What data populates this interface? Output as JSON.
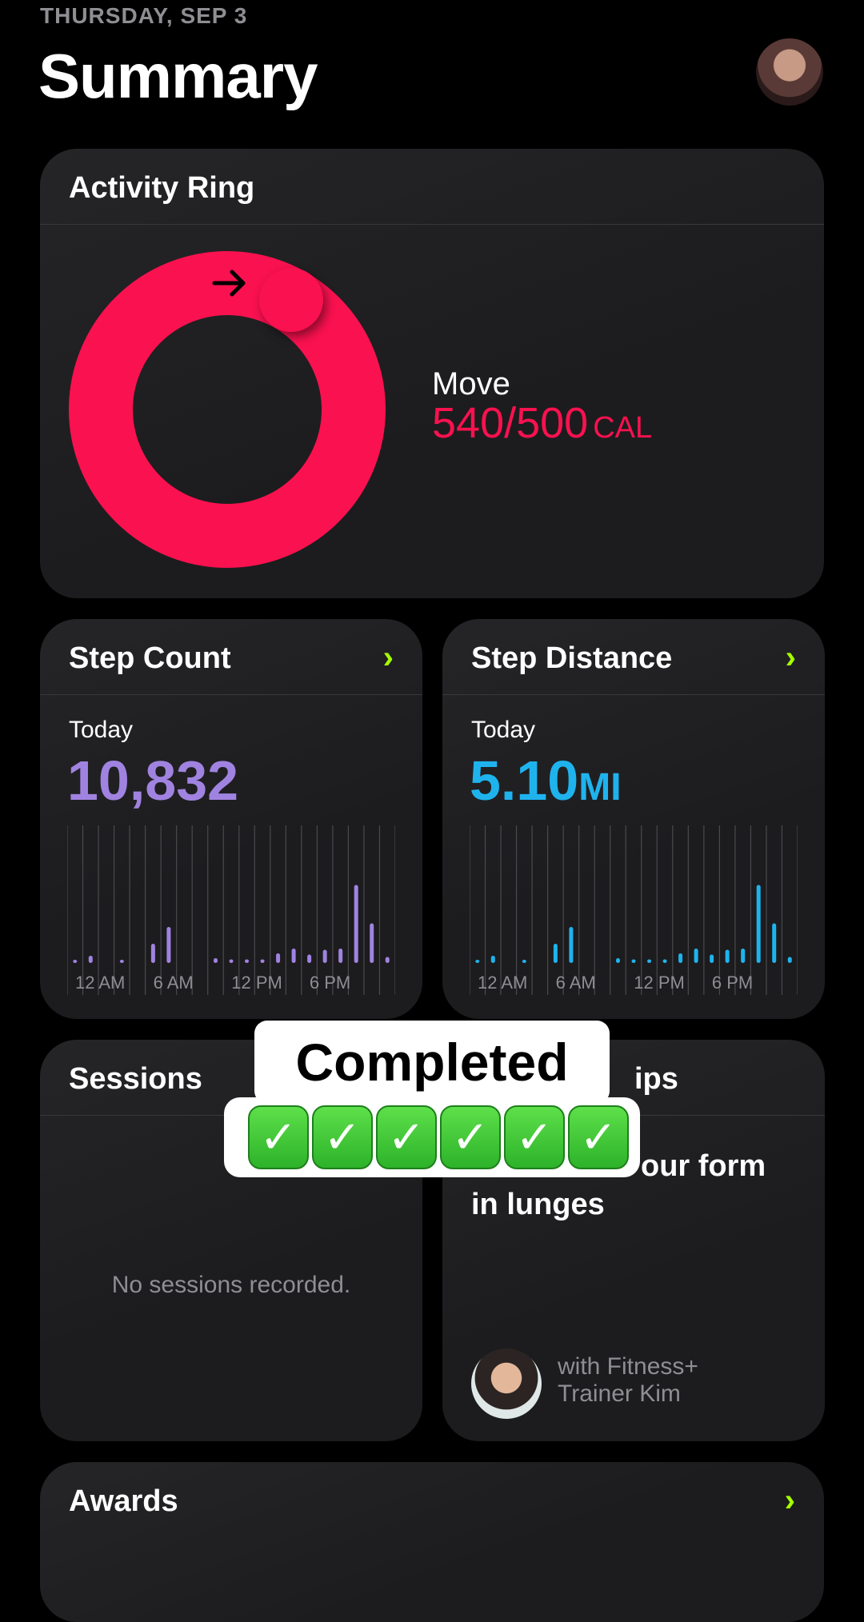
{
  "header": {
    "date": "THURSDAY, SEP 3",
    "title": "Summary"
  },
  "activity": {
    "title": "Activity Ring",
    "move_label": "Move",
    "move_value": "540/500",
    "move_unit": "CAL",
    "move_fraction": 1.08,
    "ring_color": "#fa114f"
  },
  "steps": {
    "title": "Step Count",
    "today_label": "Today",
    "value": "10,832",
    "color": "#a083e0",
    "chart_data": {
      "type": "bar",
      "x_tick_labels": [
        "12 AM",
        "6 AM",
        "12 PM",
        "6 PM"
      ],
      "values": [
        0.02,
        0.06,
        0,
        0.02,
        0,
        0.16,
        0.3,
        0,
        0,
        0.04,
        0.03,
        0.03,
        0.03,
        0.08,
        0.12,
        0.07,
        0.11,
        0.12,
        0.65,
        0.33,
        0.05,
        0
      ]
    }
  },
  "distance": {
    "title": "Step Distance",
    "today_label": "Today",
    "value": "5.10",
    "unit": "MI",
    "color": "#1fb3ee",
    "chart_data": {
      "type": "bar",
      "x_tick_labels": [
        "12 AM",
        "6 AM",
        "12 PM",
        "6 PM"
      ],
      "values": [
        0.02,
        0.06,
        0,
        0.02,
        0,
        0.16,
        0.3,
        0,
        0,
        0.04,
        0.03,
        0.03,
        0.03,
        0.08,
        0.12,
        0.07,
        0.11,
        0.12,
        0.65,
        0.33,
        0.05,
        0
      ]
    }
  },
  "sessions": {
    "title": "Sessions",
    "empty_text": "No sessions recorded."
  },
  "tips": {
    "title_visible": "ips",
    "text_line1": "our form",
    "text_line2": "in lunges",
    "trainer_line1": "with Fitness+",
    "trainer_line2": "Trainer Kim"
  },
  "awards": {
    "title": "Awards"
  },
  "overlay": {
    "text": "Completed",
    "checks": [
      "✓",
      "✓",
      "✓",
      "✓",
      "✓",
      "✓"
    ]
  },
  "colors": {
    "accent_chevron": "#a6ff00",
    "card_bg": "#1c1c1e"
  }
}
